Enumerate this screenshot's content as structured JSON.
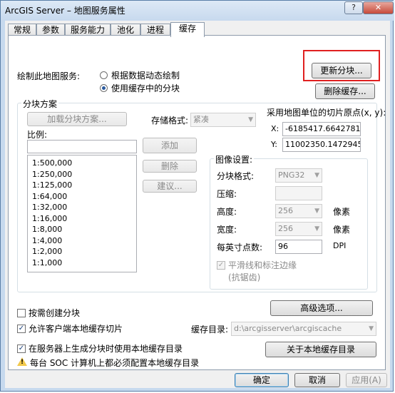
{
  "window": {
    "title": "ArcGIS Server – 地图服务属性",
    "help_label": "?",
    "close_label": "✕"
  },
  "tabs": [
    {
      "label": "常规"
    },
    {
      "label": "参数"
    },
    {
      "label": "服务能力"
    },
    {
      "label": "池化"
    },
    {
      "label": "进程"
    },
    {
      "label": "缓存"
    }
  ],
  "draw": {
    "label": "绘制此地图服务:",
    "option_dynamic": "根据数据动态绘制",
    "option_cache": "使用缓存中的分块"
  },
  "buttons": {
    "update_tiles": "更新分块...",
    "delete_cache": "删除缓存...",
    "load_scheme": "加载分块方案...",
    "add": "添加",
    "remove": "删除",
    "suggest": "建议...",
    "advanced": "高级选项...",
    "about_local_cache": "关于本地缓存目录",
    "ok": "确定",
    "cancel": "取消",
    "apply": "应用(A)"
  },
  "scheme": {
    "group_title": "分块方案",
    "scale_label": "比例:",
    "scale_value": "",
    "scales": [
      "1:500,000",
      "1:250,000",
      "1:125,000",
      "1:64,000",
      "1:32,000",
      "1:16,000",
      "1:8,000",
      "1:4,000",
      "1:2,000",
      "1:1,000"
    ],
    "storage_label": "存储格式:",
    "storage_value": "紧凑",
    "origin_label": "采用地图单位的切片原点(x, y):",
    "x_label": "X:",
    "x_value": "-6185417.66427811",
    "y_label": "Y:",
    "y_value": "11002350.1472945"
  },
  "image": {
    "group_title": "图像设置:",
    "format_label": "分块格式:",
    "format_value": "PNG32",
    "compression_label": "压缩:",
    "compression_value": "",
    "height_label": "高度:",
    "height_value": "256",
    "height_unit": "像素",
    "width_label": "宽度:",
    "width_value": "256",
    "width_unit": "像素",
    "dpi_label": "每英寸点数:",
    "dpi_value": "96",
    "dpi_unit": "DPI",
    "antialias_label": "平滑线和标注边缘",
    "antialias_sub": "(抗锯齿)"
  },
  "options": {
    "on_demand": "按需创建分块",
    "allow_client_cache": "允许客户端本地缓存切片",
    "cache_dir_label": "缓存目录:",
    "cache_dir_value": "d:\\arcgisserver\\arcgiscache",
    "use_local_cache": "在服务器上生成分块时使用本地缓存目录",
    "warning": "每台 SOC 计算机上都必须配置本地缓存目录"
  },
  "colors": {
    "highlight_box": "#e02020",
    "title_bar": "#c7d9ee"
  }
}
